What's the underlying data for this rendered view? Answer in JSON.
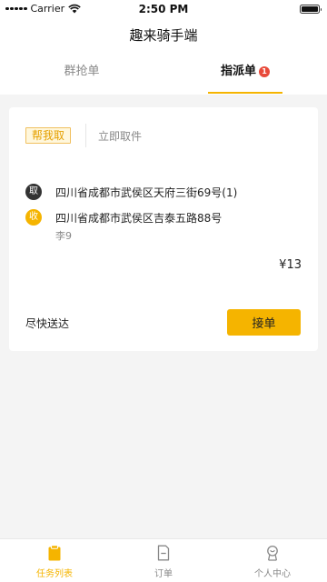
{
  "status_bar": {
    "carrier": "Carrier",
    "time": "2:50 PM"
  },
  "header": {
    "title": "趣来骑手端"
  },
  "tabs": [
    {
      "label": "群抢单",
      "active": false
    },
    {
      "label": "指派单",
      "active": true,
      "badge": "1"
    }
  ],
  "order": {
    "type_tag": "帮我取",
    "pickup_time": "立即取件",
    "pickup": {
      "icon_label": "取",
      "address": "四川省成都市武侯区天府三街69号(1)"
    },
    "delivery": {
      "icon_label": "收",
      "address": "四川省成都市武侯区吉泰五路88号",
      "name": "李9"
    },
    "price": "¥13",
    "note": "尽快送达",
    "accept_label": "接单"
  },
  "tabbar": [
    {
      "label": "任务列表",
      "icon": "clipboard-icon",
      "active": true
    },
    {
      "label": "订单",
      "icon": "document-icon",
      "active": false
    },
    {
      "label": "个人中心",
      "icon": "person-icon",
      "active": false
    }
  ],
  "colors": {
    "accent": "#f5b400",
    "badge": "#e84a3a",
    "background": "#f4f4f4"
  }
}
